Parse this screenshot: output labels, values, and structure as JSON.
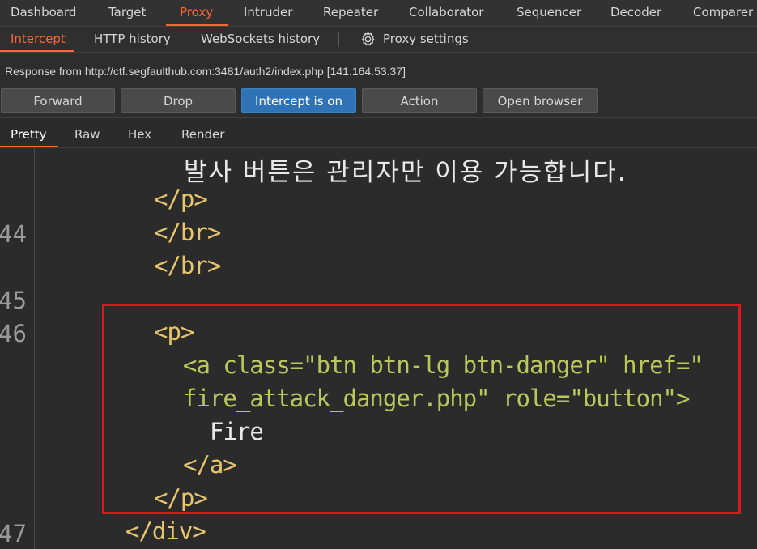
{
  "top_tabs": [
    "Dashboard",
    "Target",
    "Proxy",
    "Intruder",
    "Repeater",
    "Collaborator",
    "Sequencer",
    "Decoder",
    "Comparer"
  ],
  "sub_tabs": {
    "intercept": "Intercept",
    "http_history": "HTTP history",
    "websockets_history": "WebSockets history",
    "proxy_settings": "Proxy settings"
  },
  "info": {
    "response_line": "Response from http://ctf.segfaulthub.com:3481/auth2/index.php  [141.164.53.37]"
  },
  "buttons": {
    "forward": "Forward",
    "drop": "Drop",
    "intercept": "Intercept is on",
    "action": "Action",
    "open_browser": "Open browser"
  },
  "view_tabs": [
    "Pretty",
    "Raw",
    "Hex",
    "Render"
  ],
  "colors": {
    "accent": "#ff6633",
    "primary_button": "#2f73b6",
    "highlight_border": "#e0161f"
  },
  "editor": {
    "line_numbers": [
      "44",
      "45",
      "46",
      "47"
    ],
    "korean_text": "발사 버튼은 관리자만 이용 가능합니다.",
    "lines": {
      "close_p": "</p>",
      "close_br_1": "</br>",
      "close_br_2": "</br>",
      "open_p": "<p>",
      "a_open_start": "<a class=\"btn btn-lg btn-danger\" href=\"",
      "a_open_end": "fire_attack_danger.php\" role=\"button\">",
      "fire": "Fire",
      "close_a": "</a>",
      "close_p_2": "</p>",
      "close_div": "</div>"
    }
  }
}
